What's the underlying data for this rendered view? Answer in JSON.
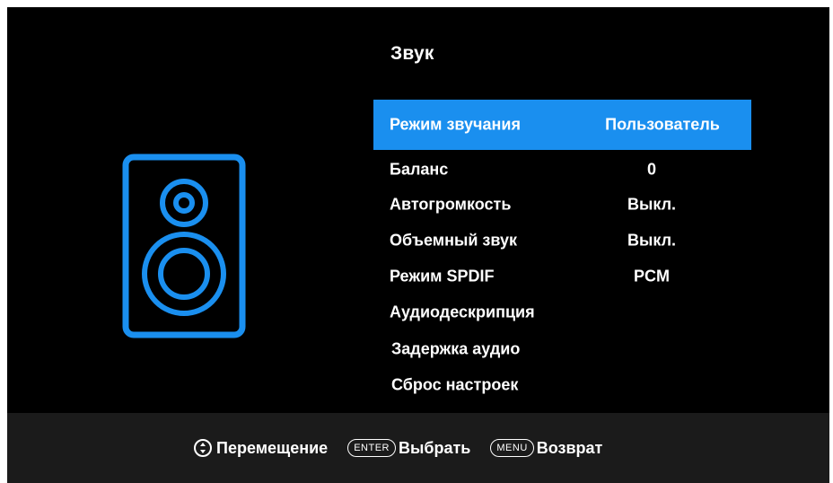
{
  "menu": {
    "title": "Звук",
    "items": [
      {
        "label": "Режим звучания",
        "value": "Пользователь"
      },
      {
        "label": "Баланс",
        "value": "0"
      },
      {
        "label": "Автогромкость",
        "value": "Выкл."
      },
      {
        "label": "Объемный звук",
        "value": "Выкл."
      },
      {
        "label": "Режим SPDIF",
        "value": "PCM"
      },
      {
        "label": "Аудиодескрипция",
        "value": ""
      },
      {
        "label": "Задержка аудио",
        "value": ""
      },
      {
        "label": "Сброс настроек",
        "value": ""
      }
    ]
  },
  "footer": {
    "navigate_label": "Перемещение",
    "enter_key": "ENTER",
    "enter_label": "Выбрать",
    "menu_key": "MENU",
    "menu_label": "Возврат"
  },
  "icons": {
    "speaker": "speaker-icon",
    "navigate": "up-down-arrows-icon"
  },
  "colors": {
    "accent": "#1a8fef",
    "background": "#000000",
    "footer_background": "#1b1b1b",
    "text": "#ffffff"
  }
}
